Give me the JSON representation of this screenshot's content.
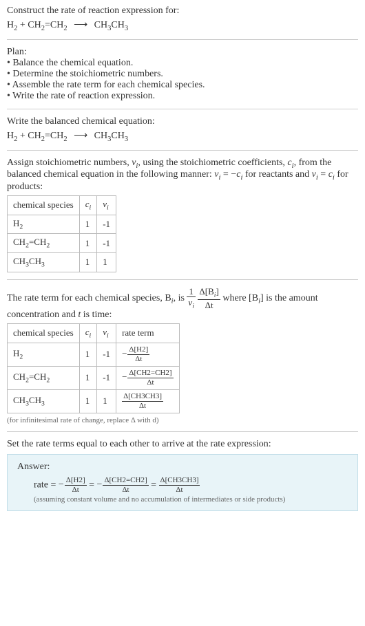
{
  "header": {
    "title": "Construct the rate of reaction expression for:",
    "equation_lhs1": "H",
    "equation_lhs1_sub": "2",
    "plus": " + ",
    "equation_lhs2a": "CH",
    "equation_lhs2a_sub": "2",
    "equation_eq": "=",
    "equation_lhs2b": "CH",
    "equation_lhs2b_sub": "2",
    "arrow": "⟶",
    "equation_rhs": "CH",
    "equation_rhs_sub1": "3",
    "equation_rhs2": "CH",
    "equation_rhs_sub2": "3"
  },
  "plan": {
    "title": "Plan:",
    "items": [
      "Balance the chemical equation.",
      "Determine the stoichiometric numbers.",
      "Assemble the rate term for each chemical species.",
      "Write the rate of reaction expression."
    ]
  },
  "balanced": {
    "title": "Write the balanced chemical equation:"
  },
  "stoich": {
    "intro1": "Assign stoichiometric numbers, ",
    "nu": "ν",
    "i": "i",
    "intro2": ", using the stoichiometric coefficients, ",
    "c": "c",
    "intro3": ", from the balanced chemical equation in the following manner: ",
    "eq1": " = −",
    "intro4": " for reactants and ",
    "eq2": " = ",
    "intro5": " for products:",
    "headers": [
      "chemical species",
      "cᵢ",
      "νᵢ"
    ],
    "h_c": "c",
    "h_nu": "ν",
    "rows": [
      {
        "sp": "H₂",
        "c": "1",
        "nu": "-1"
      },
      {
        "sp": "CH₂=CH₂",
        "c": "1",
        "nu": "-1"
      },
      {
        "sp": "CH₃CH₃",
        "c": "1",
        "nu": "1"
      }
    ]
  },
  "rateterm": {
    "intro1": "The rate term for each chemical species, B",
    "intro2": ", is ",
    "one": "1",
    "dB": "Δ[B",
    "dt": "Δt",
    "closeb": "]",
    "intro3": " where [B",
    "intro4": "] is the amount concentration and ",
    "t": "t",
    "intro5": " is time:",
    "headers": [
      "chemical species",
      "cᵢ",
      "νᵢ",
      "rate term"
    ],
    "h_rate": "rate term",
    "rows": [
      {
        "sp": "H₂",
        "c": "1",
        "nu": "-1",
        "rt_num": "Δ[H2]",
        "rt_den": "Δt",
        "neg": "−"
      },
      {
        "sp": "CH₂=CH₂",
        "c": "1",
        "nu": "-1",
        "rt_num": "Δ[CH2=CH2]",
        "rt_den": "Δt",
        "neg": "−"
      },
      {
        "sp": "CH₃CH₃",
        "c": "1",
        "nu": "1",
        "rt_num": "Δ[CH3CH3]",
        "rt_den": "Δt",
        "neg": ""
      }
    ],
    "note": "(for infinitesimal rate of change, replace Δ with d)"
  },
  "final": {
    "title": "Set the rate terms equal to each other to arrive at the rate expression:",
    "answer_label": "Answer:",
    "rate": "rate = ",
    "neg": "−",
    "eq": " = ",
    "t1_num": "Δ[H2]",
    "t1_den": "Δt",
    "t2_num": "Δ[CH2=CH2]",
    "t2_den": "Δt",
    "t3_num": "Δ[CH3CH3]",
    "t3_den": "Δt",
    "note": "(assuming constant volume and no accumulation of intermediates or side products)"
  },
  "chart_data": {
    "type": "table",
    "tables": [
      {
        "title": "Stoichiometric numbers",
        "columns": [
          "chemical species",
          "c_i",
          "ν_i"
        ],
        "rows": [
          [
            "H2",
            1,
            -1
          ],
          [
            "CH2=CH2",
            1,
            -1
          ],
          [
            "CH3CH3",
            1,
            1
          ]
        ]
      },
      {
        "title": "Rate terms",
        "columns": [
          "chemical species",
          "c_i",
          "ν_i",
          "rate term"
        ],
        "rows": [
          [
            "H2",
            1,
            -1,
            "-Δ[H2]/Δt"
          ],
          [
            "CH2=CH2",
            1,
            -1,
            "-Δ[CH2=CH2]/Δt"
          ],
          [
            "CH3CH3",
            1,
            1,
            "Δ[CH3CH3]/Δt"
          ]
        ]
      }
    ]
  }
}
